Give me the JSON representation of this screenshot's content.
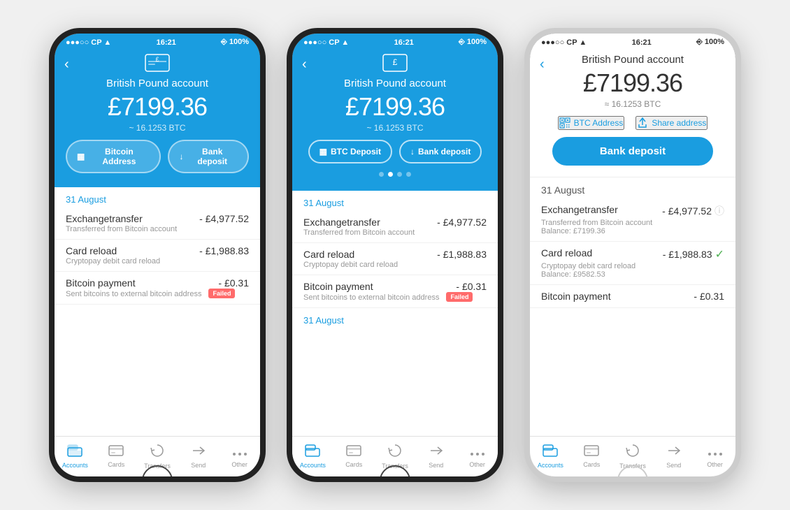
{
  "phones": [
    {
      "id": "phone1",
      "theme": "blue",
      "statusBar": {
        "left": "●●●○○ CP ▲",
        "time": "16:21",
        "right": "⎆ 100%"
      },
      "header": {
        "backLabel": "‹",
        "cardIcon": "£",
        "title": "British Pound account",
        "balance": "£7199.36",
        "balanceBtc": "~ 16.1253 BTC"
      },
      "buttons": [
        {
          "icon": "▦",
          "label": "Bitcoin Address"
        },
        {
          "icon": "↓",
          "label": "Bank deposit"
        }
      ],
      "sections": [
        {
          "date": "31 August",
          "transactions": [
            {
              "name": "Exchangetransfer",
              "sub": "Transferred from Bitcoin account",
              "amount": "- £4,977.52",
              "badge": null
            },
            {
              "name": "Card reload",
              "sub": "Cryptopay debit card reload",
              "amount": "- £1,988.83",
              "badge": null
            },
            {
              "name": "Bitcoin payment",
              "sub": "Sent bitcoins to external bitcoin address",
              "amount": "- £0.31",
              "badge": "Failed"
            }
          ]
        }
      ],
      "nav": [
        {
          "icon": "≡",
          "label": "Accounts",
          "active": true
        },
        {
          "icon": "▭",
          "label": "Cards",
          "active": false
        },
        {
          "icon": "↺",
          "label": "Transfers",
          "active": false
        },
        {
          "icon": "→",
          "label": "Send",
          "active": false
        },
        {
          "icon": "···",
          "label": "Other",
          "active": false
        }
      ]
    },
    {
      "id": "phone2",
      "theme": "blue",
      "statusBar": {
        "left": "●●●○○ CP ▲",
        "time": "16:21",
        "right": "⎆ 100%"
      },
      "header": {
        "backLabel": "‹",
        "cardIcon": "£",
        "title": "British Pound account",
        "balance": "£7199.36",
        "balanceBtc": "~ 16.1253 BTC"
      },
      "buttons": [
        {
          "icon": "▦",
          "label": "BTC Deposit"
        },
        {
          "icon": "↓",
          "label": "Bank deposit"
        }
      ],
      "dots": [
        false,
        true,
        false,
        false
      ],
      "sections": [
        {
          "date": "31 August",
          "transactions": [
            {
              "name": "Exchangetransfer",
              "sub": "Transferred from Bitcoin account",
              "amount": "- £4,977.52",
              "badge": null
            },
            {
              "name": "Card reload",
              "sub": "Cryptopay debit card reload",
              "amount": "- £1,988.83",
              "badge": null
            },
            {
              "name": "Bitcoin payment",
              "sub": "Sent bitcoins to external bitcoin address",
              "amount": "- £0.31",
              "badge": "Failed"
            }
          ]
        },
        {
          "date": "31 August",
          "transactions": []
        }
      ],
      "nav": [
        {
          "icon": "≡",
          "label": "Accounts",
          "active": true
        },
        {
          "icon": "▭",
          "label": "Cards",
          "active": false
        },
        {
          "icon": "↺",
          "label": "Transfers",
          "active": false
        },
        {
          "icon": "→",
          "label": "Send",
          "active": false
        },
        {
          "icon": "···",
          "label": "Other",
          "active": false
        }
      ]
    },
    {
      "id": "phone3",
      "theme": "white",
      "statusBar": {
        "left": "●●●○○ CP ▲",
        "time": "16:21",
        "right": "⎆ 100%"
      },
      "header": {
        "backLabel": "‹",
        "title": "British Pound account",
        "balance": "£7199.36",
        "balanceBtc": "≈ 16.1253 BTC"
      },
      "whiteButtons": [
        {
          "icon": "▦",
          "label": "BTC Address"
        },
        {
          "icon": "↑",
          "label": "Share address"
        }
      ],
      "bankDepositLabel": "Bank deposit",
      "sections": [
        {
          "date": "31 August",
          "transactions": [
            {
              "name": "Exchangetransfer",
              "sub": "Transferred from Bitcoin account",
              "balanceSub": "Balance: £7199.36",
              "amount": "- £4,977.52",
              "badge": null,
              "status": "info"
            },
            {
              "name": "Card reload",
              "sub": "Cryptopay debit card reload",
              "balanceSub": "Balance: £9582.53",
              "amount": "- £1,988.83",
              "badge": null,
              "status": "check"
            },
            {
              "name": "Bitcoin payment",
              "sub": "",
              "balanceSub": "",
              "amount": "- £0.31",
              "badge": null,
              "status": null
            }
          ]
        }
      ],
      "nav": [
        {
          "icon": "≡",
          "label": "Accounts",
          "active": true
        },
        {
          "icon": "▭",
          "label": "Cards",
          "active": false
        },
        {
          "icon": "↺",
          "label": "Transfers",
          "active": false
        },
        {
          "icon": "→",
          "label": "Send",
          "active": false
        },
        {
          "icon": "···",
          "label": "Other",
          "active": false
        }
      ]
    }
  ]
}
